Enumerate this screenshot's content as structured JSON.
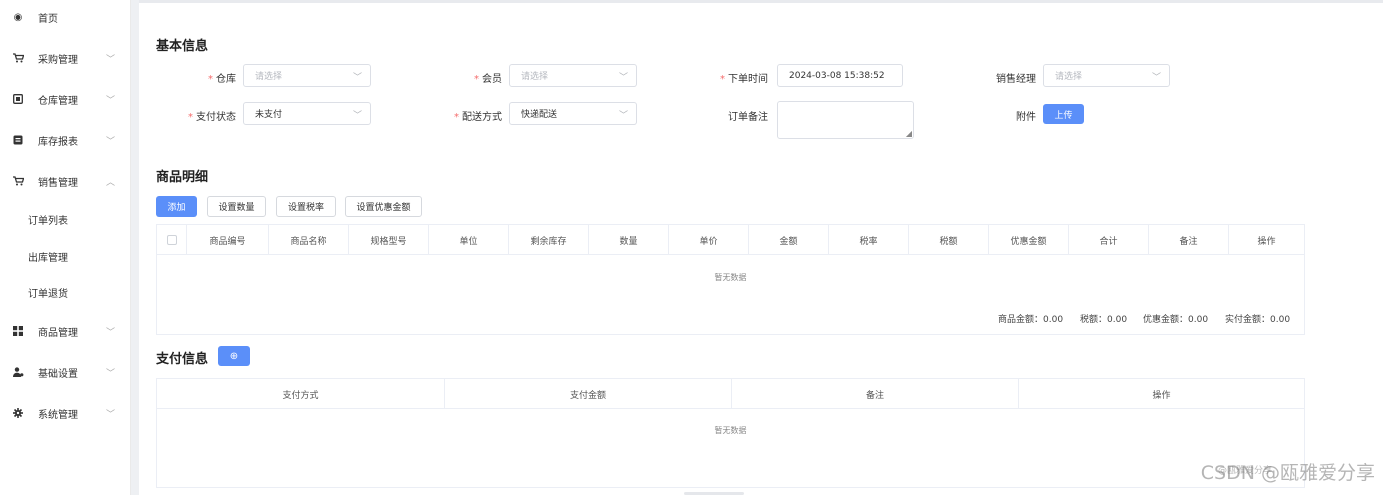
{
  "sidebar": {
    "items": [
      {
        "label": "首页",
        "icon": "dashboard-icon",
        "glyph": "◉",
        "has_children": false
      },
      {
        "label": "采购管理",
        "icon": "cart-icon",
        "glyph": "🛒",
        "has_children": true
      },
      {
        "label": "仓库管理",
        "icon": "warehouse-icon",
        "glyph": "▣",
        "has_children": true
      },
      {
        "label": "库存报表",
        "icon": "report-icon",
        "glyph": "▤",
        "has_children": true
      },
      {
        "label": "销售管理",
        "icon": "cart-icon",
        "glyph": "🛒",
        "has_children": true,
        "expanded": true
      },
      {
        "label": "商品管理",
        "icon": "grid-icon",
        "glyph": "▦",
        "has_children": true
      },
      {
        "label": "基础设置",
        "icon": "users-icon",
        "glyph": "♟",
        "has_children": true
      },
      {
        "label": "系统管理",
        "icon": "gear-icon",
        "glyph": "✺",
        "has_children": true
      }
    ],
    "sales_children": [
      "订单列表",
      "出库管理",
      "订单退货"
    ],
    "chevron_down": "﹀",
    "chevron_up": "︿"
  },
  "basic_info": {
    "title": "基本信息",
    "fields": {
      "warehouse": {
        "label": "仓库",
        "required": "*",
        "placeholder": "请选择"
      },
      "member": {
        "label": "会员",
        "required": "*",
        "placeholder": "请选择"
      },
      "order_time": {
        "label": "下单时间",
        "required": "*",
        "value": "2024-03-08 15:38:52"
      },
      "sales_manager": {
        "label": "销售经理",
        "placeholder": "请选择"
      },
      "pay_status": {
        "label": "支付状态",
        "required": "*",
        "value": "未支付"
      },
      "delivery": {
        "label": "配送方式",
        "required": "*",
        "value": "快递配送"
      },
      "order_note": {
        "label": "订单备注",
        "value": ""
      },
      "attachment": {
        "label": "附件",
        "button": "上传"
      }
    }
  },
  "goods": {
    "title": "商品明细",
    "buttons": {
      "add": "添加",
      "set_qty": "设置数量",
      "set_tax": "设置税率",
      "set_discount": "设置优惠金额"
    },
    "columns": [
      "商品编号",
      "商品名称",
      "规格型号",
      "单位",
      "剩余库存",
      "数量",
      "单价",
      "金额",
      "税率",
      "税额",
      "优惠金额",
      "合计",
      "备注",
      "操作"
    ],
    "empty_text": "暂无数据",
    "summary": {
      "goods_amount": "商品金额：0.00",
      "tax": "税额：0.00",
      "discount": "优惠金额：0.00",
      "paid": "实付金额：0.00"
    }
  },
  "payment": {
    "title": "支付信息",
    "add_icon": "⊕",
    "columns": [
      "支付方式",
      "支付金额",
      "备注",
      "操作"
    ],
    "empty_text": "暂无数据"
  },
  "watermark": {
    "text": "CSDN @瓯雅爱分享",
    "small": "@瓯雅爱分享"
  },
  "colors": {
    "primary": "#5b8ff9",
    "required": "#f56c6c"
  }
}
